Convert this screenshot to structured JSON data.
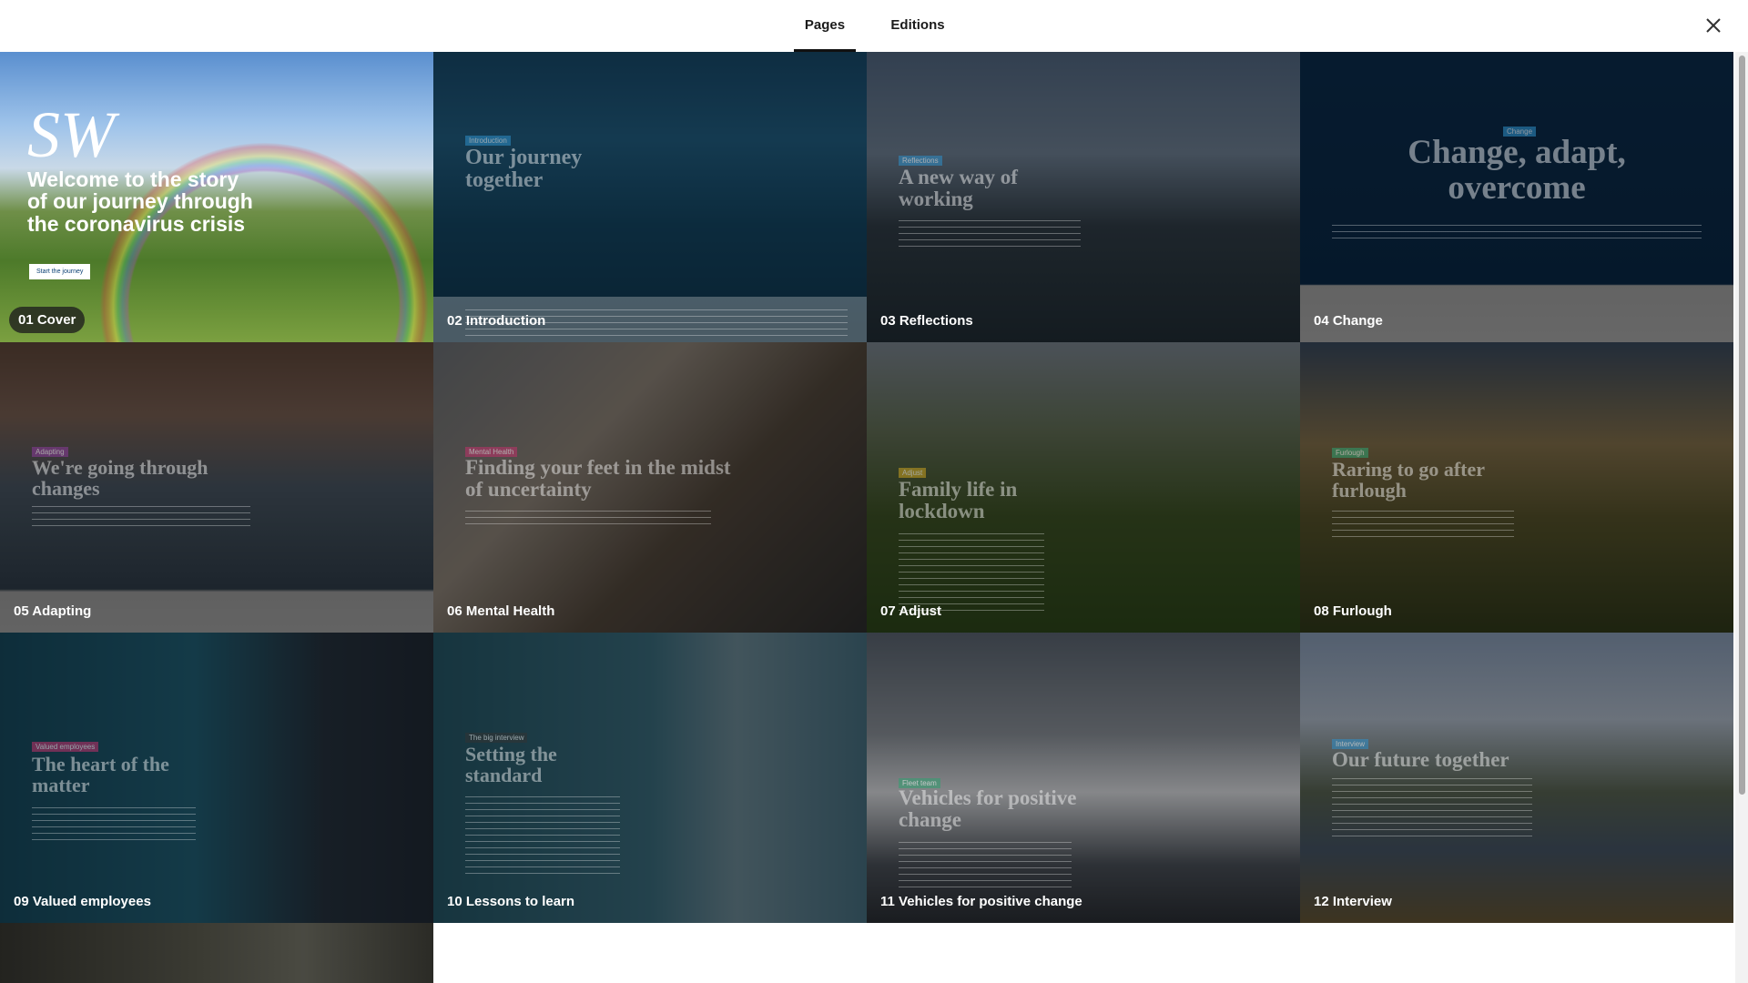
{
  "tabs": {
    "pages": "Pages",
    "editions": "Editions"
  },
  "cover": {
    "logo": "SW",
    "headline": "Welcome to the story of our journey through the coronavirus crisis",
    "button": "Start the journey"
  },
  "pages": [
    {
      "label": "01 Cover"
    },
    {
      "label": "02 Introduction",
      "tag": "Introduction",
      "headline": "Our journey together"
    },
    {
      "label": "03 Reflections",
      "tag": "Reflections",
      "headline": "A new way of working"
    },
    {
      "label": "04 Change",
      "tag": "Change",
      "headline": "Change, adapt, overcome"
    },
    {
      "label": "05 Adapting",
      "tag": "Adapting",
      "headline": "We're going through changes"
    },
    {
      "label": "06 Mental Health",
      "tag": "Mental Health",
      "headline": "Finding your feet in the midst of uncertainty"
    },
    {
      "label": "07 Adjust",
      "tag": "Adjust",
      "headline": "Family life in lockdown"
    },
    {
      "label": "08 Furlough",
      "tag": "Furlough",
      "headline": "Raring to go after furlough"
    },
    {
      "label": "09 Valued employees",
      "tag": "Valued employees",
      "headline": "The heart of the matter"
    },
    {
      "label": "10 Lessons to learn",
      "tag": "The big interview",
      "headline": "Setting the standard"
    },
    {
      "label": "11 Vehicles for positive change",
      "tag": "Fleet team",
      "headline": "Vehicles for positive change"
    },
    {
      "label": "12 Interview",
      "tag": "Interview",
      "headline": "Our future together"
    }
  ]
}
